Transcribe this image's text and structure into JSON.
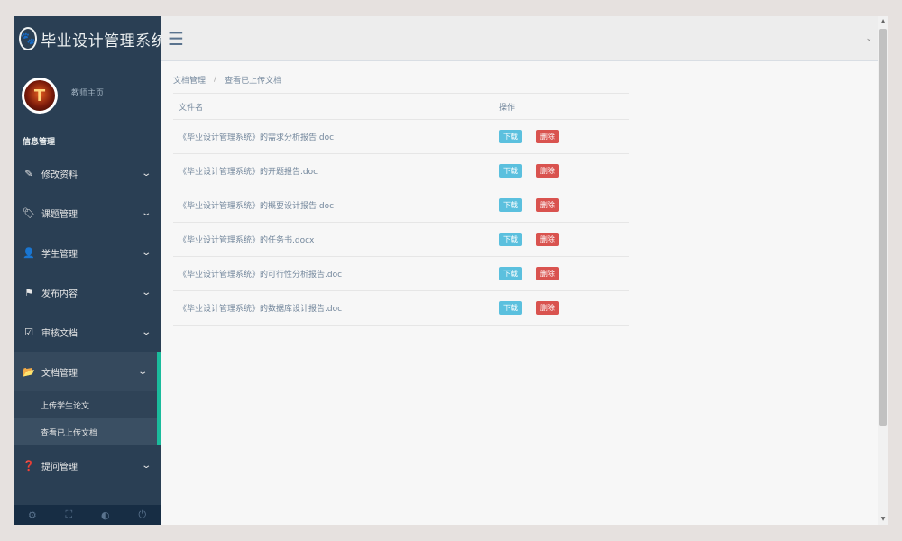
{
  "brand": {
    "title": "毕业设计管理系统",
    "logo_icon": "paw-icon"
  },
  "profile": {
    "label": "教师主页"
  },
  "sidebar": {
    "section_title": "信息管理",
    "items": [
      {
        "label": "修改资料",
        "icon": "edit-icon"
      },
      {
        "label": "课题管理",
        "icon": "tags-icon"
      },
      {
        "label": "学生管理",
        "icon": "user-icon"
      },
      {
        "label": "发布内容",
        "icon": "flag-icon"
      },
      {
        "label": "审核文档",
        "icon": "check-square-icon"
      },
      {
        "label": "文档管理",
        "icon": "folder-open-icon"
      },
      {
        "label": "提问管理",
        "icon": "question-circle-icon"
      }
    ],
    "subitems": [
      {
        "label": "上传学生论文"
      },
      {
        "label": "查看已上传文档"
      }
    ],
    "footer_icons": [
      "settings-icon",
      "fullscreen-icon",
      "lock-icon",
      "power-icon"
    ]
  },
  "breadcrumb": {
    "parent": "文档管理",
    "separator": "/",
    "current": "查看已上传文档"
  },
  "table": {
    "headers": {
      "name": "文件名",
      "action": "操作"
    },
    "rows": [
      {
        "name": "《毕业设计管理系统》的需求分析报告.doc"
      },
      {
        "name": "《毕业设计管理系统》的开题报告.doc"
      },
      {
        "name": "《毕业设计管理系统》的概要设计报告.doc"
      },
      {
        "name": "《毕业设计管理系统》的任务书.docx"
      },
      {
        "name": "《毕业设计管理系统》的可行性分析报告.doc"
      },
      {
        "name": "《毕业设计管理系统》的数据库设计报告.doc"
      }
    ],
    "download_label": "下载",
    "delete_label": "删除"
  },
  "colors": {
    "sidebar_bg": "#2a3f54",
    "accent": "#1abb9c",
    "download_btn": "#5bc0de",
    "delete_btn": "#d9534f"
  }
}
